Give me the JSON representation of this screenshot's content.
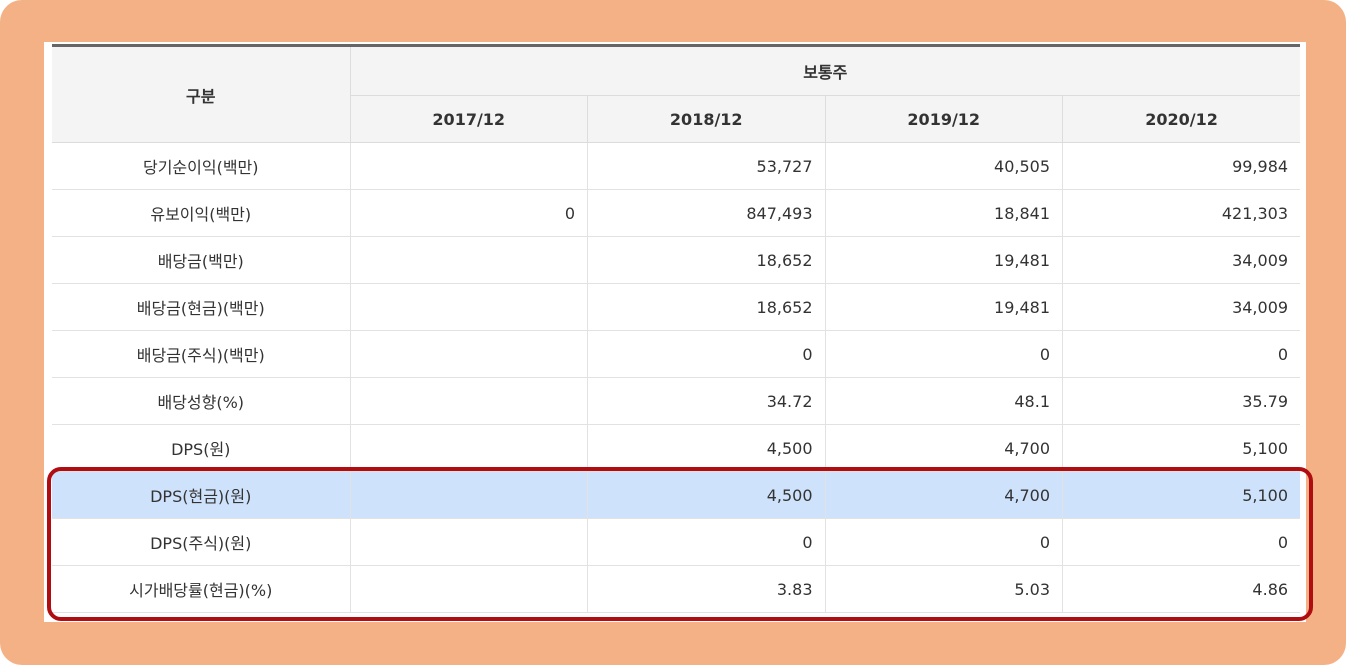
{
  "header": {
    "category_label": "구분",
    "group_label": "보통주",
    "years": [
      "2017/12",
      "2018/12",
      "2019/12",
      "2020/12"
    ]
  },
  "rows": [
    {
      "label": "당기순이익(백만)",
      "values": [
        "",
        "53,727",
        "40,505",
        "99,984"
      ]
    },
    {
      "label": "유보이익(백만)",
      "values": [
        "0",
        "847,493",
        "18,841",
        "421,303"
      ]
    },
    {
      "label": "배당금(백만)",
      "values": [
        "",
        "18,652",
        "19,481",
        "34,009"
      ]
    },
    {
      "label": "배당금(현금)(백만)",
      "values": [
        "",
        "18,652",
        "19,481",
        "34,009"
      ]
    },
    {
      "label": "배당금(주식)(백만)",
      "values": [
        "",
        "0",
        "0",
        "0"
      ]
    },
    {
      "label": "배당성향(%)",
      "values": [
        "",
        "34.72",
        "48.1",
        "35.79"
      ]
    },
    {
      "label": "DPS(원)",
      "values": [
        "",
        "4,500",
        "4,700",
        "5,100"
      ]
    },
    {
      "label": "DPS(현금)(원)",
      "values": [
        "",
        "4,500",
        "4,700",
        "5,100"
      ]
    },
    {
      "label": "DPS(주식)(원)",
      "values": [
        "",
        "0",
        "0",
        "0"
      ]
    },
    {
      "label": "시가배당률(현금)(%)",
      "values": [
        "",
        "3.83",
        "5.03",
        "4.86"
      ]
    }
  ],
  "colors": {
    "frame_background": "#f3b185",
    "highlighted_row": "#cfe2fb",
    "annotation_box": "#b00d12"
  }
}
